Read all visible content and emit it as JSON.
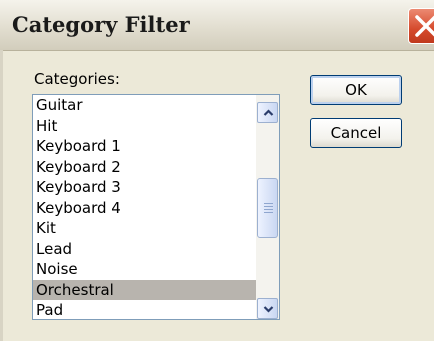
{
  "window": {
    "title": "Category Filter"
  },
  "categories": {
    "label": "Categories:",
    "items": [
      {
        "label": "Guitar"
      },
      {
        "label": "Hit"
      },
      {
        "label": "Keyboard 1"
      },
      {
        "label": "Keyboard 2"
      },
      {
        "label": "Keyboard 3"
      },
      {
        "label": "Keyboard 4"
      },
      {
        "label": "Kit"
      },
      {
        "label": "Lead"
      },
      {
        "label": "Noise"
      },
      {
        "label": "Orchestral"
      },
      {
        "label": "Pad"
      }
    ],
    "selected": "Orchestral"
  },
  "buttons": {
    "ok": "OK",
    "cancel": "Cancel"
  },
  "icons": {
    "close": "close-icon",
    "scroll_up": "chevron-up-icon",
    "scroll_down": "chevron-down-icon"
  },
  "colors": {
    "selection": "#b8b4ae",
    "close_button": "#d54a2c",
    "dialog_bg": "#ece9d8"
  }
}
